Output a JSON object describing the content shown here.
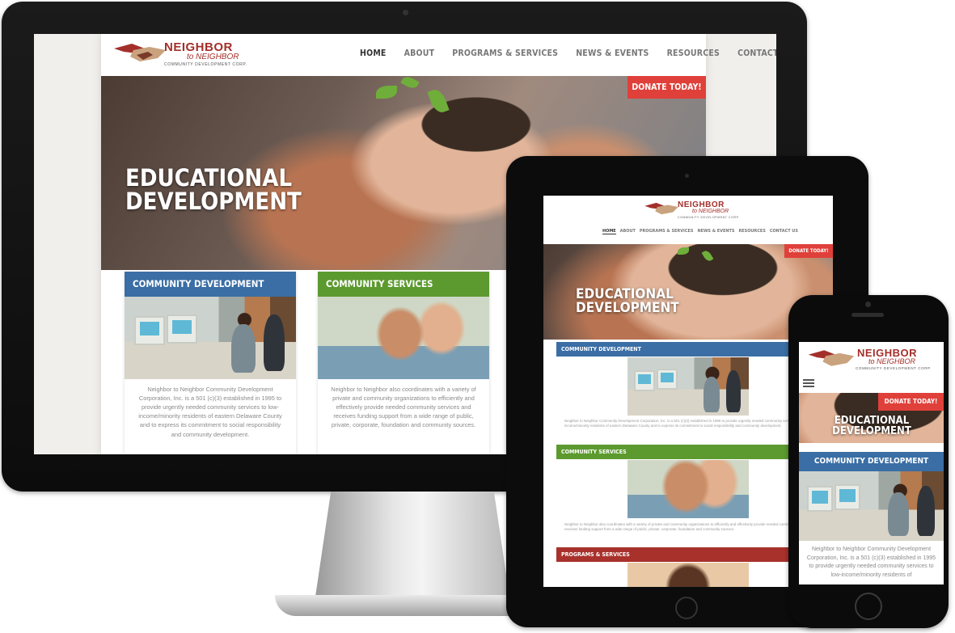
{
  "logo": {
    "line1": "NEIGHBOR",
    "line2": "to NEIGHBOR",
    "line3": "COMMUNITY DEVELOPMENT CORP."
  },
  "nav": {
    "items": [
      "HOME",
      "ABOUT",
      "PROGRAMS & SERVICES",
      "NEWS & EVENTS",
      "RESOURCES",
      "CONTACT US"
    ],
    "active": "HOME"
  },
  "hero": {
    "title_line1": "EDUCATIONAL",
    "title_line2": "DEVELOPMENT",
    "donate_label": "DONATE TODAY!"
  },
  "cards": [
    {
      "title": "COMMUNITY DEVELOPMENT",
      "color": "#3a6ea5",
      "text": "Neighbor to Neighbor Community Development Corporation, Inc. is a 501 (c)(3) established in 1995 to provide urgently needed community services to low-income/minority residents of eastern Delaware County and to express its commitment to social responsibility and community development."
    },
    {
      "title": "COMMUNITY SERVICES",
      "color": "#5c9a2f",
      "text": "Neighbor to Neighbor also coordinates with a variety of private and community organizations to efficiently and effectively provide needed community services and receives funding support from a wide range of public, private, corporate, foundation and community sources."
    }
  ],
  "tablet": {
    "strip3_title": "PROGRAMS & SERVICES",
    "strip3_color": "#a8312c",
    "text1": "Neighbor to Neighbor Community Development Corporation, Inc. is a 501 (c)(3) established in 1995 to provide urgently needed community services to low-income/minority residents of eastern Delaware County and to express its commitment to social responsibility and community development.",
    "text2": "Neighbor to Neighbor also coordinates with a variety of private and community organizations to efficiently and effectively provide needed community services and receives funding support from a wide range of public, private, corporate, foundation and community sources."
  },
  "phone": {
    "menu_icon": "hamburger-icon",
    "text": "Neighbor to Neighbor Community Development Corporation, Inc. is a 501 (c)(3) established in 1995 to provide urgently needed community services to low-income/minority residents of"
  },
  "colors": {
    "accent_red": "#e0403a",
    "brand_red": "#a32f2a",
    "blue": "#3a6ea5",
    "green": "#5c9a2f"
  }
}
